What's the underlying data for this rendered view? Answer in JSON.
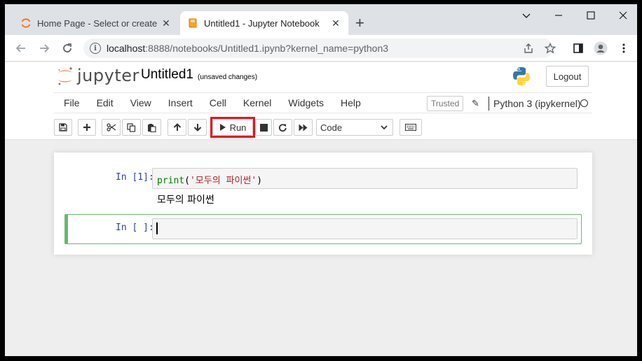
{
  "browser": {
    "tabs": [
      {
        "title": "Home Page - Select or create a",
        "active": false,
        "icon": "jupyter-spinner-icon"
      },
      {
        "title": "Untitled1 - Jupyter Notebook",
        "active": true,
        "icon": "notebook-book-icon"
      }
    ],
    "new_tab_label": "+",
    "window_controls": {
      "dropdown": "⌄",
      "minimize": "—",
      "maximize": "☐",
      "close": "✕"
    },
    "url_host": "localhost",
    "url_rest": ":8888/notebooks/Untitled1.ipynb?kernel_name=python3",
    "colors": {
      "tabbar": "#dee1e6",
      "omnibox": "#f1f3f4"
    }
  },
  "jupyter": {
    "logo_text": "jupyter",
    "notebook_name": "Untitled1",
    "autosave_status": "(unsaved changes)",
    "logout_label": "Logout",
    "menu": [
      "File",
      "Edit",
      "View",
      "Insert",
      "Cell",
      "Kernel",
      "Widgets",
      "Help"
    ],
    "trusted_label": "Trusted",
    "kernel_name": "Python 3 (ipykernel)",
    "toolbar": {
      "run_label": "Run",
      "cell_type": "Code",
      "icons": [
        "save-icon",
        "plus-icon",
        "cut-icon",
        "copy-icon",
        "paste-icon",
        "arrow-up-icon",
        "arrow-down-icon",
        "play-icon",
        "stop-icon",
        "restart-icon",
        "fast-forward-icon",
        "keyboard-icon"
      ]
    },
    "colors": {
      "run_highlight": "#e8141e",
      "prompt": "#303f9f",
      "selected_cell": "#66bb6a",
      "string": "#ba2121",
      "builtin": "#008000"
    }
  },
  "cells": [
    {
      "prompt": "In [1]:",
      "code_func": "print",
      "code_open": "(",
      "code_string": "'모두의 파이썬'",
      "code_close": ")",
      "output": "모두의 파이썬"
    },
    {
      "prompt": "In [ ]:",
      "code": ""
    }
  ]
}
